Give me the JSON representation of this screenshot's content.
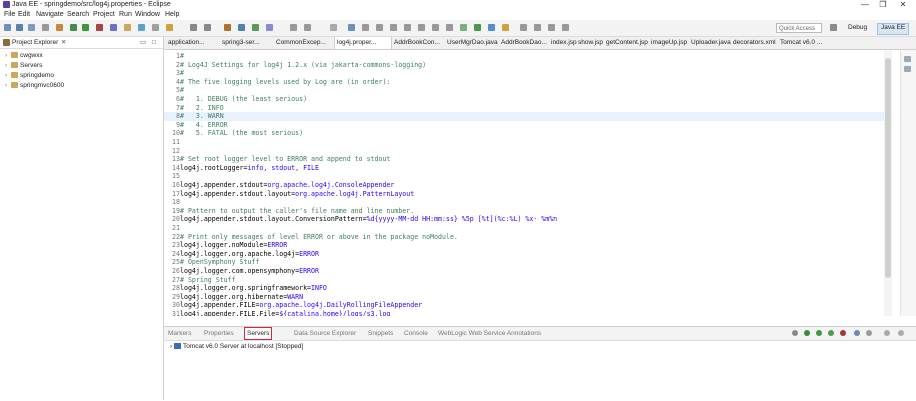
{
  "window": {
    "title": "Java EE - springdemo/src/log4j.properties - Eclipse",
    "controls": [
      "—",
      "❐",
      "✕"
    ]
  },
  "menu": [
    "File",
    "Edit",
    "Navigate",
    "Search",
    "Project",
    "Run",
    "Window",
    "Help"
  ],
  "toolbar": {
    "quick_access_placeholder": "Quick Access",
    "perspectives": [
      "Debug",
      "Java EE"
    ]
  },
  "explorer": {
    "title": "Project Explorer",
    "close": "✕",
    "items": [
      "cwgwxx",
      "Servers",
      "springdemo",
      "springmvc0600"
    ]
  },
  "editor_tabs": [
    "application...",
    "spring3-ser...",
    "CommonExcep...",
    "log4j.proper...",
    "AddrBookCon...",
    "UserMgrDao.java",
    "AddrBookDao...",
    "index.jsp",
    "show.jsp",
    "getContent.jsp",
    "imageUp.jsp",
    "Uploader.java",
    "decorators.xml",
    "Tomcat v6.0 ..."
  ],
  "code_lines": [
    {
      "n": "1",
      "t": "#",
      "k": "com"
    },
    {
      "n": "2",
      "t": "# Log4J Settings for log4j 1.2.x (via jakarta-commons-logging)",
      "k": "com"
    },
    {
      "n": "3",
      "t": "#",
      "k": "com"
    },
    {
      "n": "4",
      "t": "# The five logging levels used by Log are (in order):",
      "k": "com"
    },
    {
      "n": "5",
      "t": "#",
      "k": "com"
    },
    {
      "n": "6",
      "t": "#   1. DEBUG (the least serious)",
      "k": "com"
    },
    {
      "n": "7",
      "t": "#   2. INFO",
      "k": "com"
    },
    {
      "n": "8",
      "t": "#   3. WARN",
      "k": "com",
      "cur": true
    },
    {
      "n": "9",
      "t": "#   4. ERROR",
      "k": "com"
    },
    {
      "n": "10",
      "t": "#   5. FATAL (the most serious)",
      "k": "com"
    },
    {
      "n": "11",
      "t": "",
      "k": "com"
    },
    {
      "n": "12",
      "t": "",
      "k": "com"
    },
    {
      "n": "13",
      "t": "# Set root logger level to ERROR and append to stdout",
      "k": "com"
    },
    {
      "n": "14",
      "t": "log4j.rootLogger=",
      "v": "info, stdout, FILE",
      "k": "kv"
    },
    {
      "n": "15",
      "t": "",
      "k": "com"
    },
    {
      "n": "16",
      "t": "log4j.appender.stdout=",
      "v": "org.apache.log4j.ConsoleAppender",
      "k": "kv"
    },
    {
      "n": "17",
      "t": "log4j.appender.stdout.layout=",
      "v": "org.apache.log4j.PatternLayout",
      "k": "kv"
    },
    {
      "n": "18",
      "t": "",
      "k": "com"
    },
    {
      "n": "19",
      "t": "# Pattern to output the caller's file name and line number.",
      "k": "com"
    },
    {
      "n": "20",
      "t": "log4j.appender.stdout.layout.ConversionPattern=",
      "v": "%d{yyyy-MM-dd HH:mm:ss} %5p [%t](%c:%L) %x- %m%n",
      "k": "kv"
    },
    {
      "n": "21",
      "t": "",
      "k": "com"
    },
    {
      "n": "22",
      "t": "# Print only messages of level ERROR or above in the package noModule.",
      "k": "com"
    },
    {
      "n": "23",
      "t": "log4j.logger.noModule=",
      "v": "ERROR",
      "k": "kv"
    },
    {
      "n": "24",
      "t": "log4j.logger.org.apache.log4j=",
      "v": "ERROR",
      "k": "kv"
    },
    {
      "n": "25",
      "t": "# OpenSymphony Stuff",
      "k": "com"
    },
    {
      "n": "26",
      "t": "log4j.logger.com.opensymphony=",
      "v": "ERROR",
      "k": "kv"
    },
    {
      "n": "27",
      "t": "# Spring Stuff",
      "k": "com"
    },
    {
      "n": "28",
      "t": "log4j.logger.org.springframework=",
      "v": "INFO",
      "k": "kv"
    },
    {
      "n": "29",
      "t": "log4j.logger.org.hibernate=",
      "v": "WARN",
      "k": "kv"
    },
    {
      "n": "30",
      "t": "log4j.appender.FILE=",
      "v": "org.apache.log4j.DailyRollingFileAppender",
      "k": "kv"
    },
    {
      "n": "31",
      "t": "log4j.appender.FILE.File=",
      "v": "${catalina.home}/logs/s3.log",
      "k": "kv"
    }
  ],
  "bottom": {
    "tabs": [
      "Markers",
      "Properties",
      "Servers",
      "Data Source Explorer",
      "Snippets",
      "Console",
      "WebLogic Web Service Annotations"
    ],
    "server_row": "Tomcat v6.0 Server at localhost  [Stopped]"
  }
}
